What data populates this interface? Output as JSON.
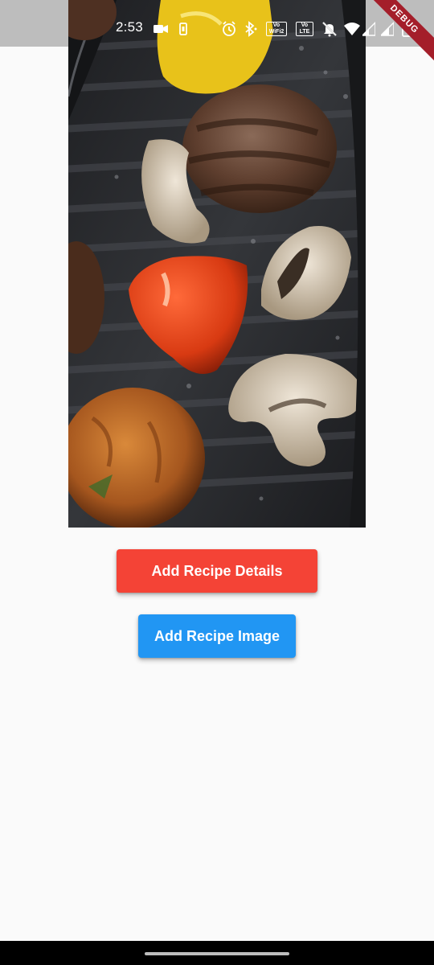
{
  "status_bar": {
    "time": "2:53",
    "icons": [
      "video-camera-icon",
      "phone-screen-icon",
      "alarm-icon",
      "bluetooth-icon",
      "vowifi2-icon",
      "volte-icon",
      "bell-off-icon",
      "wifi-icon",
      "signal-icon",
      "signal-icon",
      "battery-icon"
    ],
    "vowifi_badge": "Vo WiFi2",
    "volte_badge": "Vo LTE",
    "background_color": "#bdbdbd"
  },
  "debug_banner": {
    "label": "DEBUG",
    "color": "#a41e2a"
  },
  "recipe_image": {
    "description_icon": "food-photo-grilled-burgers-vegetables"
  },
  "actions": {
    "add_details_label": "Add Recipe Details",
    "add_image_label": "Add Recipe Image",
    "add_details_color": "#f44336",
    "add_image_color": "#2196f3"
  },
  "navigation": {
    "handle": "gesture-handle"
  }
}
